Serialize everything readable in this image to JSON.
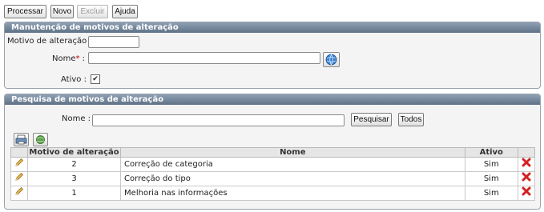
{
  "toolbar": {
    "processar": "Processar",
    "novo": "Novo",
    "excluir": "Excluir",
    "ajuda": "Ajuda"
  },
  "maintenance": {
    "title": "Manutenção de motivos de alteração",
    "motivo_label": "Motivo de alteração :",
    "motivo_value": "",
    "nome_label": "Nome",
    "required_mark": "*",
    "nome_colon": " :",
    "nome_value": "",
    "ativo_label": "Ativo :",
    "ativo_checked": true,
    "lookup_icon": "globe-search-icon"
  },
  "search": {
    "title": "Pesquisa de motivos de alteração",
    "nome_label": "Nome :",
    "nome_value": "",
    "pesquisar": "Pesquisar",
    "todos": "Todos",
    "print_icon": "printer-icon",
    "export_icon": "globe-export-icon"
  },
  "table": {
    "headers": [
      "",
      "Motivo de alteração",
      "Nome",
      "Ativo",
      ""
    ],
    "rows": [
      {
        "motivo": "2",
        "nome": "Correção de categoria",
        "ativo": "Sim"
      },
      {
        "motivo": "3",
        "nome": "Correção do tipo",
        "ativo": "Sim"
      },
      {
        "motivo": "1",
        "nome": "Melhoria nas informações",
        "ativo": "Sim"
      }
    ],
    "edit_icon": "pencil-icon",
    "delete_icon": "delete-x-icon"
  },
  "colors": {
    "header_top": "#8fa0b4",
    "header_bottom": "#5f7287",
    "delete_red": "#d42020",
    "pencil": "#e8b84a"
  }
}
